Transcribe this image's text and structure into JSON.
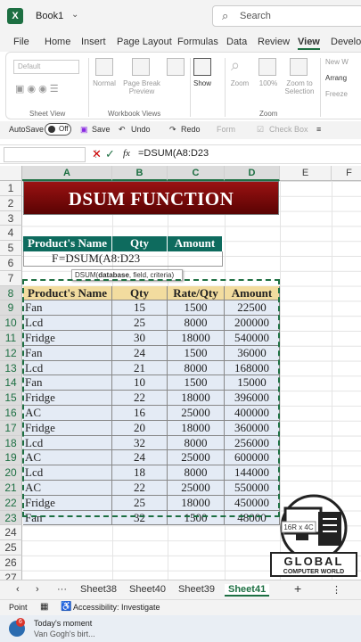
{
  "titlebar": {
    "filename": "Book1",
    "search_placeholder": "Search"
  },
  "menu": [
    "File",
    "Home",
    "Insert",
    "Page Layout",
    "Formulas",
    "Data",
    "Review",
    "View",
    "Develop"
  ],
  "menu_active": "View",
  "ribbon": {
    "sheet_view": {
      "dropdown": "Default",
      "label": "Sheet View"
    },
    "workbook_views": {
      "normal": "Normal",
      "page_break": "Page Break Preview",
      "label": "Workbook Views"
    },
    "show": "Show",
    "zoom": {
      "zoom": "Zoom",
      "hundred": "100%",
      "to_sel": "Zoom to Selection",
      "label": "Zoom"
    },
    "window": {
      "new": "New W",
      "arrange": "Arrang",
      "freeze": "Freeze"
    }
  },
  "qat": {
    "autosave": "AutoSave",
    "toggle": "Off",
    "save": "Save",
    "undo": "Undo",
    "redo": "Redo",
    "form": "Form",
    "checkbox": "Check Box"
  },
  "formula_bar": {
    "fx": "fx",
    "content": "=DSUM(A8:D23"
  },
  "columns": [
    "A",
    "B",
    "C",
    "D",
    "E",
    "F"
  ],
  "rows": [
    "1",
    "2",
    "3",
    "4",
    "5",
    "6",
    "7",
    "8",
    "9",
    "10",
    "11",
    "12",
    "13",
    "14",
    "15",
    "16",
    "17",
    "18",
    "19",
    "20",
    "21",
    "22",
    "23",
    "24",
    "25",
    "26",
    "27"
  ],
  "title": "DSUM FUNCTION",
  "criteria": {
    "headers": [
      "Product's Name",
      "Qty",
      "Amount"
    ],
    "row6_a": "F",
    "row6_b": "=DSUM(A8:D23"
  },
  "tooltip": {
    "fn": "DSUM(",
    "bold": "database",
    "rest": ", field, criteria)"
  },
  "table": {
    "headers": [
      "Product's Name",
      "Qty",
      "Rate/Qty",
      "Amount"
    ],
    "rows": [
      [
        "Fan",
        "15",
        "1500",
        "22500"
      ],
      [
        "Lcd",
        "25",
        "8000",
        "200000"
      ],
      [
        "Fridge",
        "30",
        "18000",
        "540000"
      ],
      [
        "Fan",
        "24",
        "1500",
        "36000"
      ],
      [
        "Lcd",
        "21",
        "8000",
        "168000"
      ],
      [
        "Fan",
        "10",
        "1500",
        "15000"
      ],
      [
        "Fridge",
        "22",
        "18000",
        "396000"
      ],
      [
        "AC",
        "16",
        "25000",
        "400000"
      ],
      [
        "Fridge",
        "20",
        "18000",
        "360000"
      ],
      [
        "Lcd",
        "32",
        "8000",
        "256000"
      ],
      [
        "AC",
        "24",
        "25000",
        "600000"
      ],
      [
        "Lcd",
        "18",
        "8000",
        "144000"
      ],
      [
        "AC",
        "22",
        "25000",
        "550000"
      ],
      [
        "Fridge",
        "25",
        "18000",
        "450000"
      ],
      [
        "Fan",
        "32",
        "1500",
        "48000"
      ]
    ]
  },
  "sheets": [
    "Sheet38",
    "Sheet40",
    "Sheet39",
    "Sheet41"
  ],
  "sheet_active": "Sheet41",
  "status": {
    "mode": "Point",
    "accessibility": "Accessibility: Investigate"
  },
  "taskbar": {
    "title": "Today's moment",
    "sub": "Van Gogh's birt..."
  },
  "watermark": {
    "line1": "GLOBAL",
    "line2": "COMPUTER WORLD",
    "tag": "16R x 4C"
  }
}
